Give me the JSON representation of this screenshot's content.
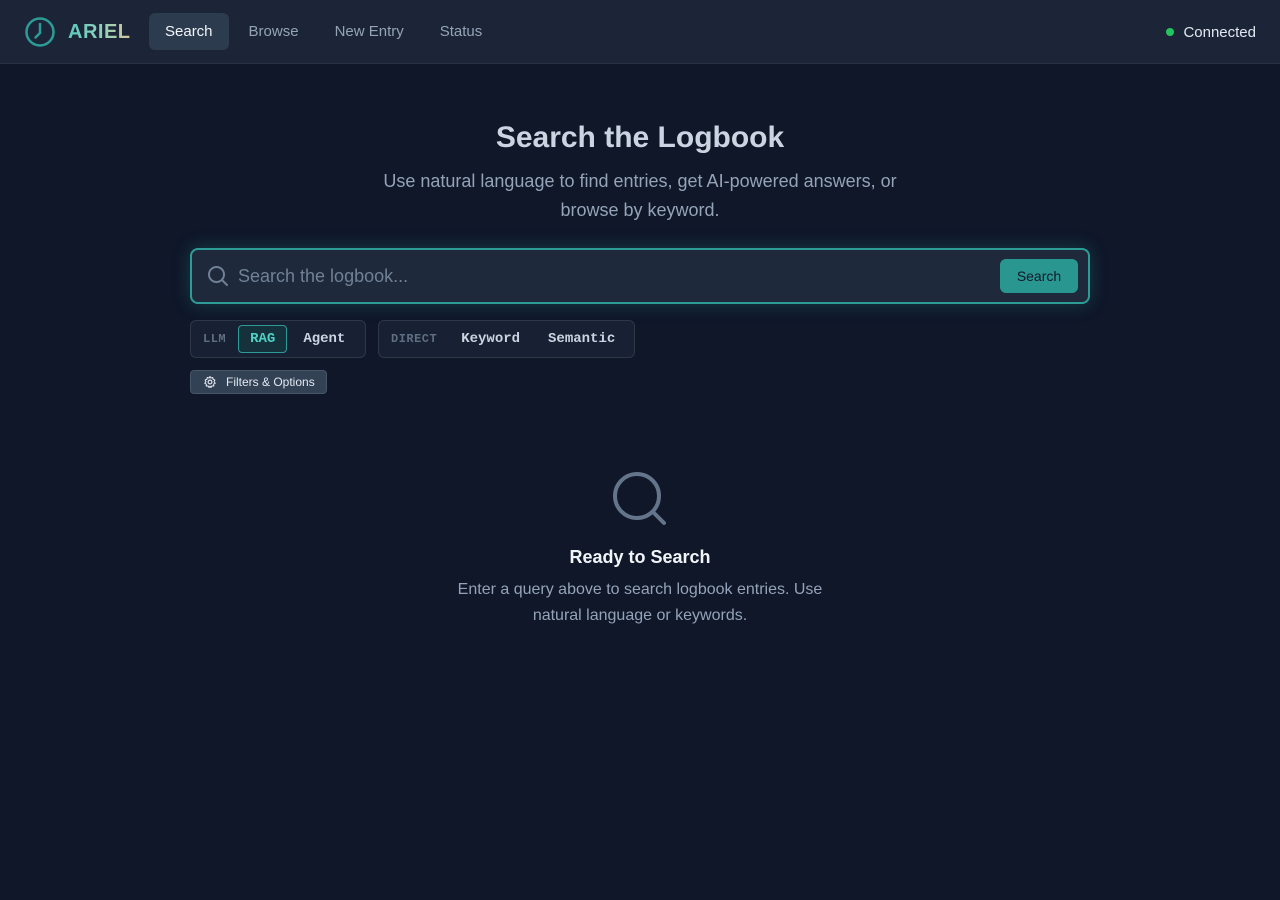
{
  "app": {
    "name": "ARIEL",
    "logo_icon": "gauge-icon"
  },
  "nav": {
    "items": [
      {
        "label": "Search",
        "active": true
      },
      {
        "label": "Browse",
        "active": false
      },
      {
        "label": "New Entry",
        "active": false
      },
      {
        "label": "Status",
        "active": false
      }
    ]
  },
  "connection": {
    "label": "Connected",
    "color": "#22c55e"
  },
  "hero": {
    "title": "Search the Logbook",
    "subtitle": "Use natural language to find entries, get AI-powered answers, or browse by keyword."
  },
  "search": {
    "placeholder": "Search the logbook...",
    "value": "",
    "button_label": "Search",
    "icon": "search-icon"
  },
  "modes": {
    "llm": {
      "label": "LLM",
      "options": [
        {
          "label": "RAG",
          "active": true
        },
        {
          "label": "Agent",
          "active": false
        }
      ]
    },
    "direct": {
      "label": "DIRECT",
      "options": [
        {
          "label": "Keyword",
          "active": false
        },
        {
          "label": "Semantic",
          "active": false
        }
      ]
    }
  },
  "filters": {
    "label": "Filters & Options",
    "icon": "gear-icon"
  },
  "empty_state": {
    "icon": "search-icon",
    "title": "Ready to Search",
    "text": "Enter a query above to search logbook entries. Use natural language or keywords."
  },
  "colors": {
    "accent": "#2d9c96",
    "background": "#0f1729",
    "header": "#1b2537"
  }
}
